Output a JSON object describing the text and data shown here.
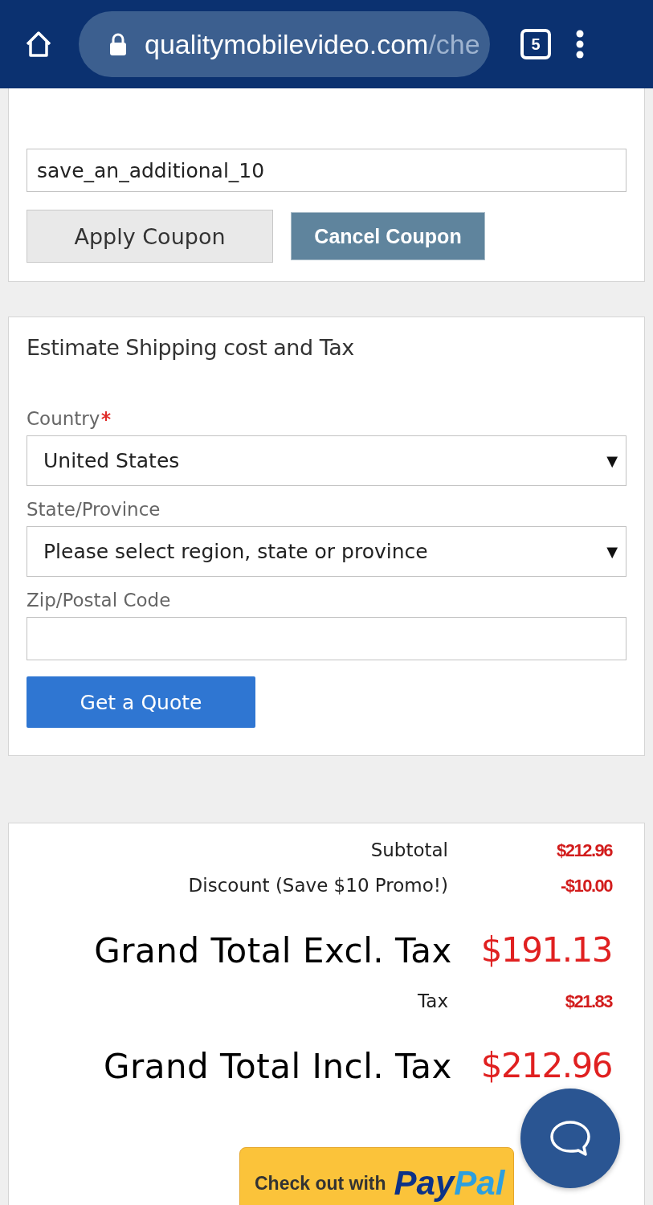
{
  "browser_bar": {
    "url_host": "qualitymobilevideo.com",
    "url_path": "/che",
    "tab_count": "5"
  },
  "coupon": {
    "code_value": "save_an_additional_10",
    "apply_button": "Apply Coupon",
    "cancel_button": "Cancel Coupon"
  },
  "shipping": {
    "title": "Estimate Shipping cost and Tax",
    "fields": [
      {
        "kind": "select",
        "label": "Country",
        "required": true,
        "value": "United States",
        "caret": "▼"
      },
      {
        "kind": "select",
        "label": "State/Province",
        "required": false,
        "value": "Please select region, state or province",
        "caret": "▼"
      },
      {
        "kind": "text",
        "label": "Zip/Postal Code",
        "required": false
      }
    ],
    "quote_button": "Get a Quote"
  },
  "totals": [
    {
      "kind": "small",
      "label": "Subtotal",
      "amount": "$212.96"
    },
    {
      "kind": "small",
      "label": "Discount (Save $10 Promo!)",
      "amount": "-$10.00"
    },
    {
      "kind": "large",
      "label": "Grand Total Excl. Tax",
      "amount": "$191.13"
    },
    {
      "kind": "small",
      "label": "Tax",
      "amount": "$21.83"
    },
    {
      "kind": "large",
      "label": "Grand Total Incl. Tax",
      "amount": "$212.96"
    }
  ],
  "paypal_button": {
    "label": "Check out with",
    "logo_first": "Pay",
    "logo_second": "Pal"
  }
}
